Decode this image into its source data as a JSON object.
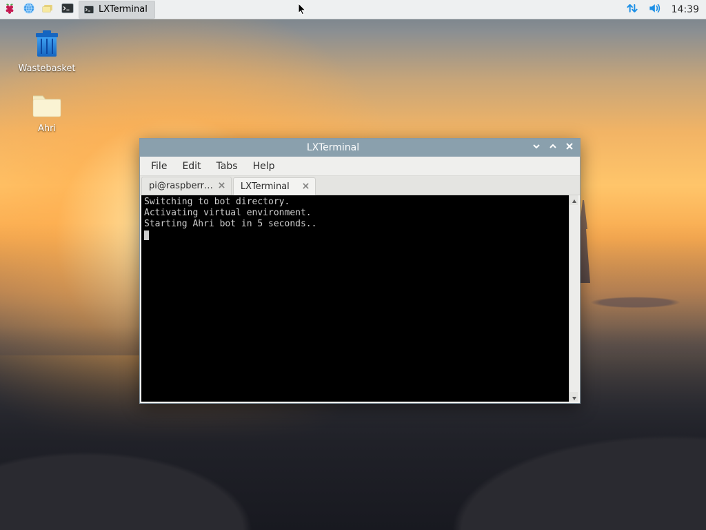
{
  "panel": {
    "taskbar_item_label": "LXTerminal",
    "clock": "14:39"
  },
  "desktop": {
    "icons": [
      {
        "label": "Wastebasket"
      },
      {
        "label": "Ahri"
      }
    ]
  },
  "window": {
    "title": "LXTerminal",
    "menubar": [
      "File",
      "Edit",
      "Tabs",
      "Help"
    ],
    "tabs": [
      {
        "label": "pi@raspberr…",
        "active": false
      },
      {
        "label": "LXTerminal",
        "active": true
      }
    ],
    "terminal_lines": [
      "Switching to bot directory.",
      "Activating virtual environment.",
      "Starting Ahri bot in 5 seconds.."
    ]
  }
}
